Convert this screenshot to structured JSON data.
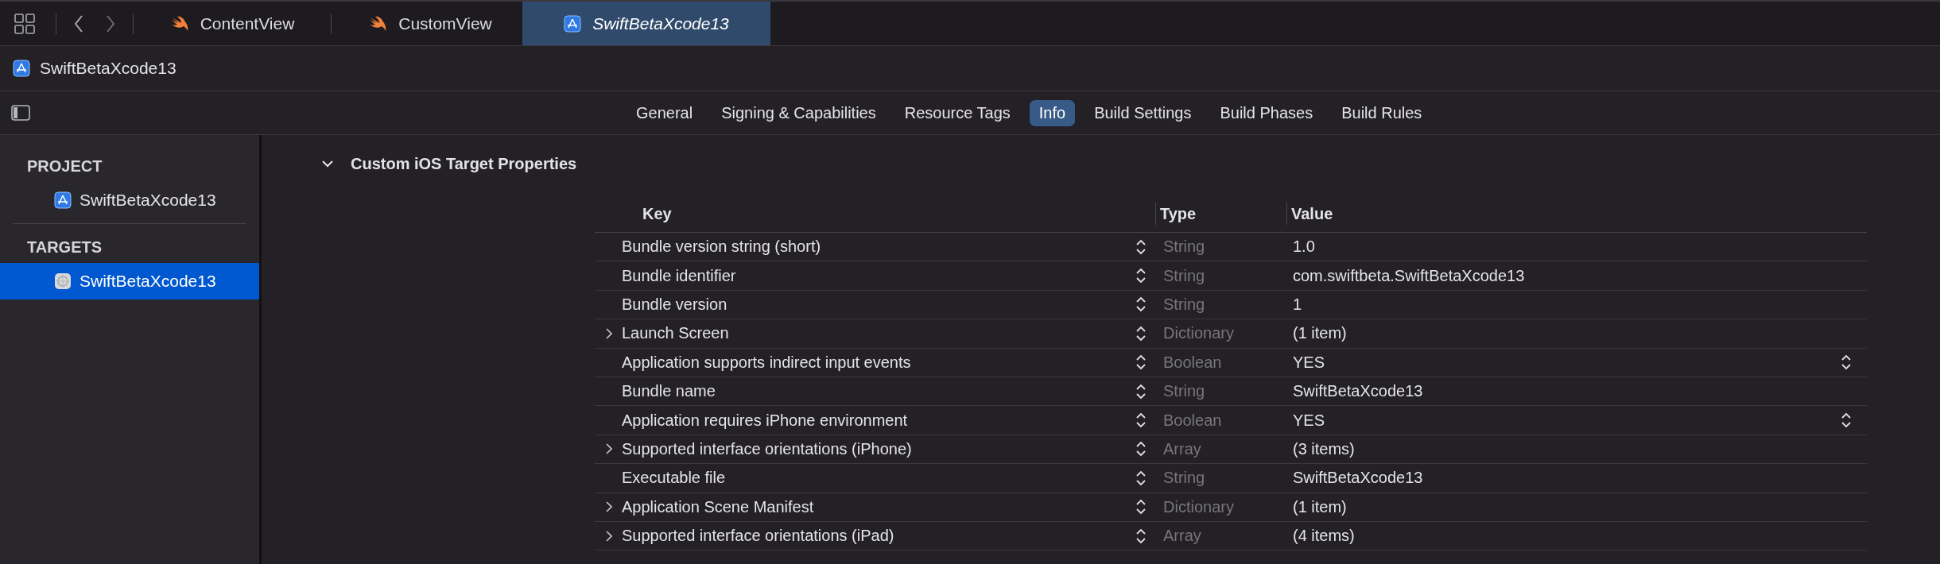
{
  "editor_tabs": [
    {
      "label": "ContentView",
      "kind": "swift",
      "selected": false
    },
    {
      "label": "CustomView",
      "kind": "swift",
      "selected": false
    },
    {
      "label": "SwiftBetaXcode13",
      "kind": "app",
      "selected": true
    }
  ],
  "breadcrumb": {
    "label": "SwiftBetaXcode13"
  },
  "editor_tabs_bar": {
    "segments": [
      {
        "label": "General",
        "selected": false
      },
      {
        "label": "Signing & Capabilities",
        "selected": false
      },
      {
        "label": "Resource Tags",
        "selected": false
      },
      {
        "label": "Info",
        "selected": true
      },
      {
        "label": "Build Settings",
        "selected": false
      },
      {
        "label": "Build Phases",
        "selected": false
      },
      {
        "label": "Build Rules",
        "selected": false
      }
    ]
  },
  "sidebar": {
    "sections": [
      {
        "title": "PROJECT",
        "items": [
          {
            "label": "SwiftBetaXcode13",
            "kind": "project",
            "selected": false
          }
        ]
      },
      {
        "title": "TARGETS",
        "items": [
          {
            "label": "SwiftBetaXcode13",
            "kind": "target",
            "selected": true
          }
        ]
      }
    ]
  },
  "section": {
    "title": "Custom iOS Target Properties",
    "expanded": true
  },
  "table": {
    "columns": [
      "Key",
      "Type",
      "Value"
    ],
    "rows": [
      {
        "key": "Bundle version string (short)",
        "type": "String",
        "value": "1.0",
        "expandable": false,
        "value_popup": false
      },
      {
        "key": "Bundle identifier",
        "type": "String",
        "value": "com.swiftbeta.SwiftBetaXcode13",
        "expandable": false,
        "value_popup": false
      },
      {
        "key": "Bundle version",
        "type": "String",
        "value": "1",
        "expandable": false,
        "value_popup": false
      },
      {
        "key": "Launch Screen",
        "type": "Dictionary",
        "value": "(1 item)",
        "expandable": true,
        "value_popup": false
      },
      {
        "key": "Application supports indirect input events",
        "type": "Boolean",
        "value": "YES",
        "expandable": false,
        "value_popup": true
      },
      {
        "key": "Bundle name",
        "type": "String",
        "value": "SwiftBetaXcode13",
        "expandable": false,
        "value_popup": false
      },
      {
        "key": "Application requires iPhone environment",
        "type": "Boolean",
        "value": "YES",
        "expandable": false,
        "value_popup": true
      },
      {
        "key": "Supported interface orientations (iPhone)",
        "type": "Array",
        "value": "(3 items)",
        "expandable": true,
        "value_popup": false
      },
      {
        "key": "Executable file",
        "type": "String",
        "value": "SwiftBetaXcode13",
        "expandable": false,
        "value_popup": false
      },
      {
        "key": "Application Scene Manifest",
        "type": "Dictionary",
        "value": "(1 item)",
        "expandable": true,
        "value_popup": false
      },
      {
        "key": "Supported interface orientations (iPad)",
        "type": "Array",
        "value": "(4 items)",
        "expandable": true,
        "value_popup": false
      }
    ]
  }
}
